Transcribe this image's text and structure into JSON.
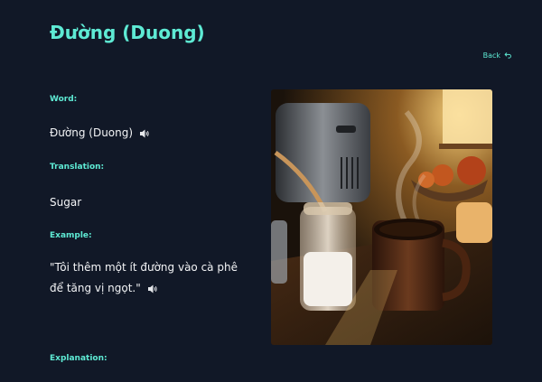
{
  "page": {
    "title": "Đường (Duong)",
    "back_label": "Back"
  },
  "word": {
    "label": "Word:",
    "value": "Đường (Duong)"
  },
  "translation": {
    "label": "Translation:",
    "value": "Sugar"
  },
  "example": {
    "label": "Example:",
    "value": "\"Tôi thêm một ít đường vào cà phê để tăng vị ngọt.\""
  },
  "explanation": {
    "label": "Explanation:"
  },
  "colors": {
    "background": "#111827",
    "accent": "#5eead4",
    "text": "#f3f4f6"
  },
  "icons": [
    "back-arrow-icon",
    "speaker-icon"
  ]
}
